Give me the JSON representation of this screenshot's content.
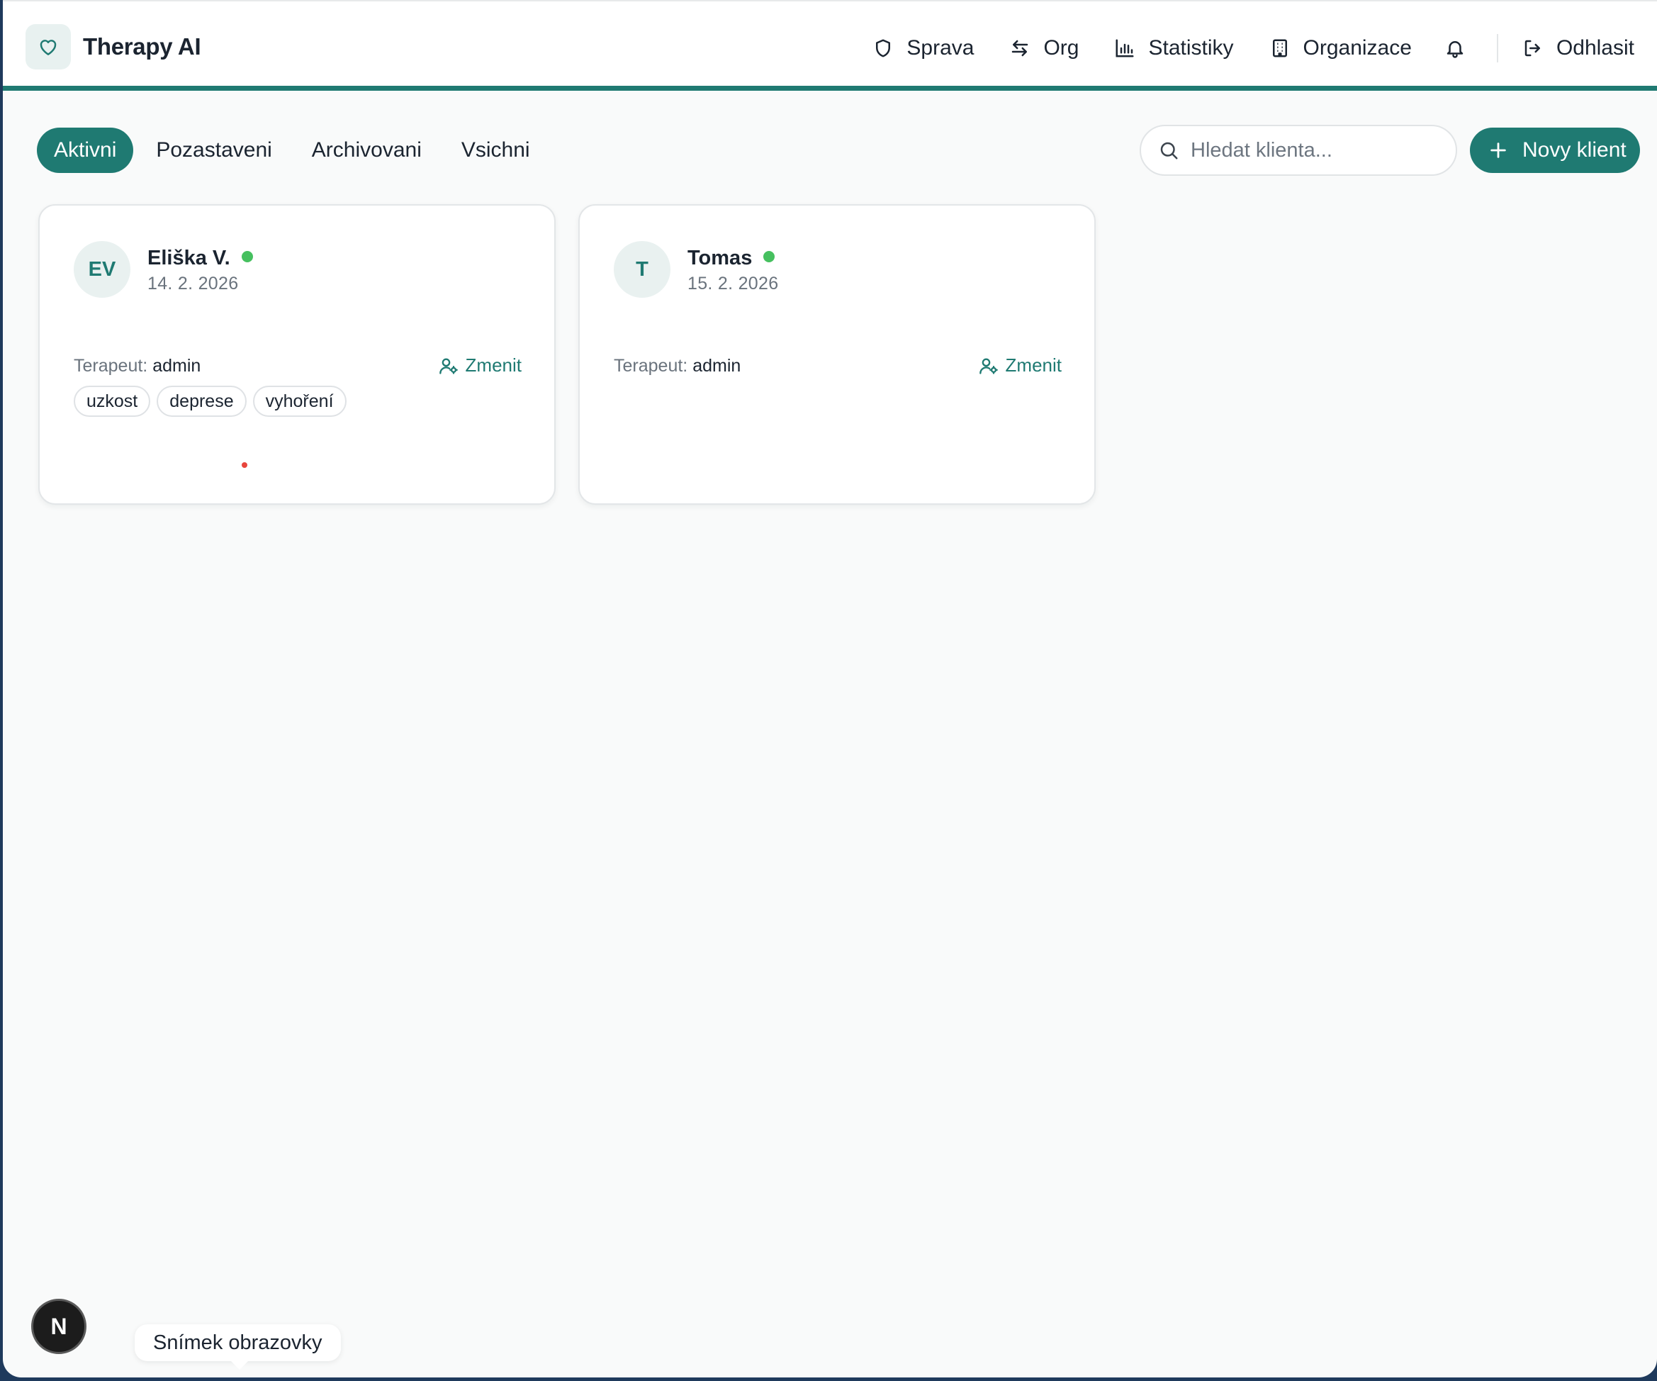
{
  "app": {
    "title": "Therapy AI",
    "logo_icon": "heart-icon"
  },
  "nav": {
    "items": [
      {
        "label": "Sprava",
        "icon": "shield-icon"
      },
      {
        "label": "Org",
        "icon": "switch-arrows-icon"
      },
      {
        "label": "Statistiky",
        "icon": "bar-chart-icon"
      },
      {
        "label": "Organizace",
        "icon": "building-icon"
      }
    ],
    "notifications_icon": "bell-icon",
    "logout": {
      "label": "Odhlasit",
      "icon": "logout-icon"
    }
  },
  "filters": {
    "tabs": [
      {
        "label": "Aktivni",
        "active": true
      },
      {
        "label": "Pozastaveni",
        "active": false
      },
      {
        "label": "Archivovani",
        "active": false
      },
      {
        "label": "Vsichni",
        "active": false
      }
    ]
  },
  "search": {
    "placeholder": "Hledat klienta...",
    "value": ""
  },
  "new_client_button": {
    "label": "Novy klient",
    "icon": "plus-icon"
  },
  "clients": [
    {
      "initials": "EV",
      "name": "Eliška V.",
      "date": "14. 2. 2026",
      "therapist_label": "Terapeut:",
      "therapist": "admin",
      "change_label": "Zmenit",
      "tags": [
        "uzkost",
        "deprese",
        "vyhoření"
      ]
    },
    {
      "initials": "T",
      "name": "Tomas",
      "date": "15. 2. 2026",
      "therapist_label": "Terapeut:",
      "therapist": "admin",
      "change_label": "Zmenit",
      "tags": []
    }
  ],
  "dev_badge": {
    "label": "N"
  },
  "tooltip": {
    "text": "Snímek obrazovky"
  },
  "colors": {
    "accent": "#1f7a72",
    "status_active": "#46c05f",
    "background": "#f9fafa"
  }
}
